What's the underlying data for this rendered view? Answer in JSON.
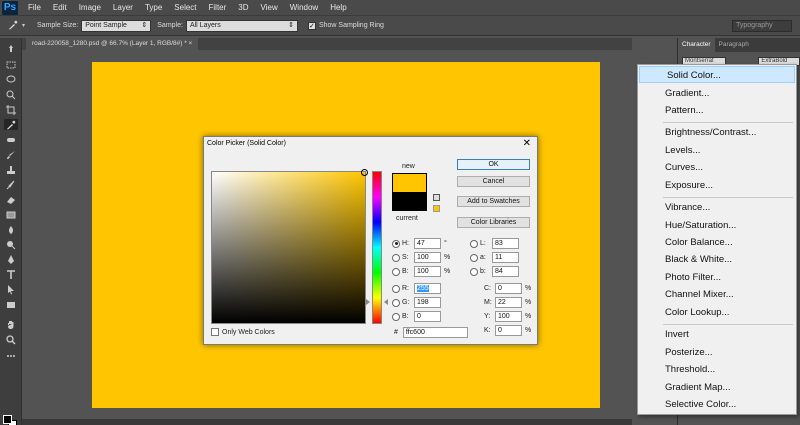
{
  "app": {
    "logo": "Ps"
  },
  "menubar": [
    "File",
    "Edit",
    "Image",
    "Layer",
    "Type",
    "Select",
    "Filter",
    "3D",
    "View",
    "Window",
    "Help"
  ],
  "options": {
    "sample_size_label": "Sample Size:",
    "sample_size_value": "Point Sample",
    "sample_label": "Sample:",
    "sample_value": "All Layers",
    "ring_label": "Show Sampling Ring",
    "workspace": "Typography"
  },
  "document": {
    "tab": "road-220058_1280.psd @ 66.7% (Layer 1, RGB/8#) *  ×"
  },
  "panel": {
    "tabs": [
      "Character",
      "Paragraph"
    ],
    "font_field": "Montserrat",
    "style_field": "ExtraBold"
  },
  "colors": {
    "fill": "#ffc600",
    "accent": "#31a8ff",
    "menu_highlight": "#cde8ff"
  },
  "dialog": {
    "title": "Color Picker (Solid Color)",
    "close": "✕",
    "new_label": "new",
    "current_label": "current",
    "buttons": {
      "ok": "OK",
      "cancel": "Cancel",
      "swatches": "Add to Swatches",
      "libraries": "Color Libraries"
    },
    "web_colors_label": "Only Web Colors",
    "fields": {
      "H": {
        "label": "H:",
        "value": "47",
        "unit": "°"
      },
      "S": {
        "label": "S:",
        "value": "100",
        "unit": "%"
      },
      "B": {
        "label": "B:",
        "value": "100",
        "unit": "%"
      },
      "R": {
        "label": "R:",
        "value": "255",
        "unit": ""
      },
      "G": {
        "label": "G:",
        "value": "198",
        "unit": ""
      },
      "Bl": {
        "label": "B:",
        "value": "0",
        "unit": ""
      },
      "L": {
        "label": "L:",
        "value": "83",
        "unit": ""
      },
      "a": {
        "label": "a:",
        "value": "11",
        "unit": ""
      },
      "b": {
        "label": "b:",
        "value": "84",
        "unit": ""
      },
      "C": {
        "label": "C:",
        "value": "0",
        "unit": "%"
      },
      "M": {
        "label": "M:",
        "value": "22",
        "unit": "%"
      },
      "Y": {
        "label": "Y:",
        "value": "100",
        "unit": "%"
      },
      "K": {
        "label": "K:",
        "value": "0",
        "unit": "%"
      }
    },
    "hex_label": "#",
    "hex_value": "ffc600"
  },
  "dropdown": {
    "items": [
      "Solid Color...",
      "Gradient...",
      "Pattern...",
      "Brightness/Contrast...",
      "Levels...",
      "Curves...",
      "Exposure...",
      "Vibrance...",
      "Hue/Saturation...",
      "Color Balance...",
      "Black & White...",
      "Photo Filter...",
      "Channel Mixer...",
      "Color Lookup...",
      "Invert",
      "Posterize...",
      "Threshold...",
      "Gradient Map...",
      "Selective Color..."
    ],
    "active_index": 0
  }
}
